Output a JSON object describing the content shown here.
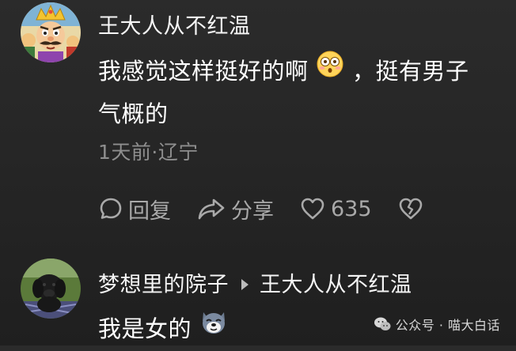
{
  "comments": [
    {
      "username": "王大人从不红温",
      "text_line_1": "我感觉这样挺好的啊",
      "text_after_emoji": "，挺有男子",
      "text_line_2": "气概的",
      "emoji": "flushed-face-emoji",
      "meta": "1天前·辽宁",
      "actions": {
        "reply_label": "回复",
        "share_label": "分享",
        "like_count": "635"
      }
    },
    {
      "username": "梦想里的院子",
      "reply_to": "王大人从不红温",
      "text": "我是女的",
      "emoji": "dog-face-emoji"
    }
  ],
  "watermark": {
    "text": "公众号 · 喵大白话",
    "icon": "wechat-icon"
  },
  "colors": {
    "background": "#262626",
    "text": "#ffffff",
    "muted": "#8e8e8e",
    "action": "#a9a9a9"
  }
}
